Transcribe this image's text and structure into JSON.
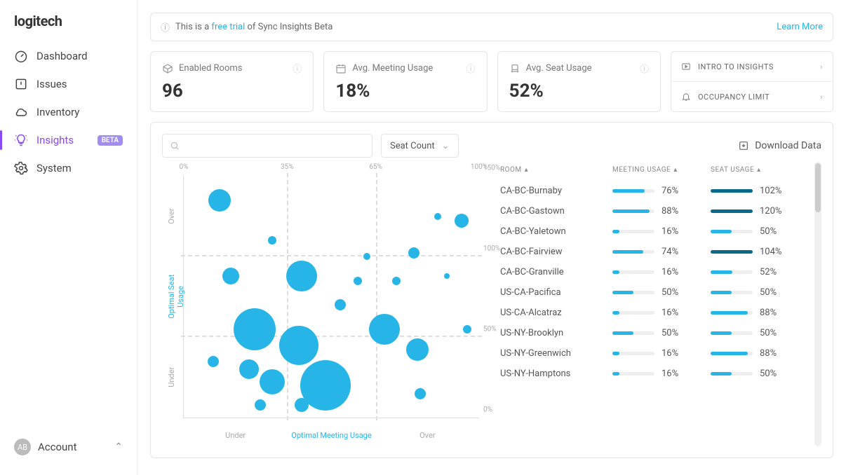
{
  "brand": "logitech",
  "sidebar": {
    "items": [
      {
        "label": "Dashboard",
        "icon": "gauge"
      },
      {
        "label": "Issues",
        "icon": "alert"
      },
      {
        "label": "Inventory",
        "icon": "cloud"
      },
      {
        "label": "Insights",
        "icon": "bulb",
        "active": true,
        "badge": "BETA"
      },
      {
        "label": "System",
        "icon": "gear"
      }
    ]
  },
  "account": {
    "initials": "AB",
    "label": "Account"
  },
  "trial": {
    "prefix": "This is a ",
    "link": "free trial",
    "suffix": " of Sync Insights Beta",
    "learn": "Learn More"
  },
  "kpis": [
    {
      "label": "Enabled Rooms",
      "value": "96"
    },
    {
      "label": "Avg. Meeting Usage",
      "value": "18%"
    },
    {
      "label": "Avg. Seat Usage",
      "value": "52%"
    }
  ],
  "sideLinks": [
    {
      "label": "INTRO TO INSIGHTS"
    },
    {
      "label": "OCCUPANCY LIMIT"
    }
  ],
  "filters": {
    "dropdown": "Seat Count",
    "download": "Download Data"
  },
  "table": {
    "headers": {
      "room": "ROOM",
      "mu": "MEETING USAGE",
      "su": "SEAT USAGE"
    },
    "rows": [
      {
        "room": "CA-BC-Burnaby",
        "mu": 76,
        "su": 102
      },
      {
        "room": "CA-BC-Gastown",
        "mu": 88,
        "su": 120
      },
      {
        "room": "CA-BC-Yaletown",
        "mu": 16,
        "su": 50
      },
      {
        "room": "CA-BC-Fairview",
        "mu": 74,
        "su": 104
      },
      {
        "room": "CA-BC-Granville",
        "mu": 16,
        "su": 52
      },
      {
        "room": "US-CA-Pacifica",
        "mu": 50,
        "su": 50
      },
      {
        "room": "US-CA-Alcatraz",
        "mu": 16,
        "su": 88
      },
      {
        "room": "US-NY-Brooklyn",
        "mu": 50,
        "su": 50
      },
      {
        "room": "US-NY-Greenwich",
        "mu": 16,
        "su": 88
      },
      {
        "room": "US-NY-Hamptons",
        "mu": 16,
        "su": 50
      }
    ]
  },
  "chart_data": {
    "type": "scatter",
    "title": "",
    "xlabel_segments": [
      "Under",
      "Optimal Meeting Usage",
      "Over"
    ],
    "ylabel_segments": [
      "Under",
      "Optimal Seat Usage",
      "Over"
    ],
    "x_ticks_pct": [
      0,
      35,
      65,
      100
    ],
    "y_ticks_pct": [
      0,
      50,
      100,
      150
    ],
    "xlim": [
      0,
      100
    ],
    "ylim": [
      0,
      150
    ],
    "bubbles": [
      {
        "x": 12,
        "y": 135,
        "r": 16
      },
      {
        "x": 30,
        "y": 110,
        "r": 6
      },
      {
        "x": 86,
        "y": 125,
        "r": 5
      },
      {
        "x": 94,
        "y": 122,
        "r": 10
      },
      {
        "x": 78,
        "y": 102,
        "r": 8
      },
      {
        "x": 62,
        "y": 100,
        "r": 5
      },
      {
        "x": 89,
        "y": 88,
        "r": 4
      },
      {
        "x": 72,
        "y": 85,
        "r": 6
      },
      {
        "x": 59,
        "y": 85,
        "r": 6
      },
      {
        "x": 40,
        "y": 88,
        "r": 22
      },
      {
        "x": 16,
        "y": 88,
        "r": 12
      },
      {
        "x": 24,
        "y": 55,
        "r": 30
      },
      {
        "x": 39,
        "y": 45,
        "r": 28
      },
      {
        "x": 53,
        "y": 70,
        "r": 8
      },
      {
        "x": 68,
        "y": 55,
        "r": 22
      },
      {
        "x": 79,
        "y": 42,
        "r": 16
      },
      {
        "x": 96,
        "y": 55,
        "r": 6
      },
      {
        "x": 10,
        "y": 35,
        "r": 8
      },
      {
        "x": 22,
        "y": 30,
        "r": 14
      },
      {
        "x": 30,
        "y": 22,
        "r": 18
      },
      {
        "x": 48,
        "y": 20,
        "r": 36
      },
      {
        "x": 40,
        "y": 8,
        "r": 10
      },
      {
        "x": 26,
        "y": 8,
        "r": 8
      },
      {
        "x": 80,
        "y": 15,
        "r": 8
      }
    ]
  }
}
